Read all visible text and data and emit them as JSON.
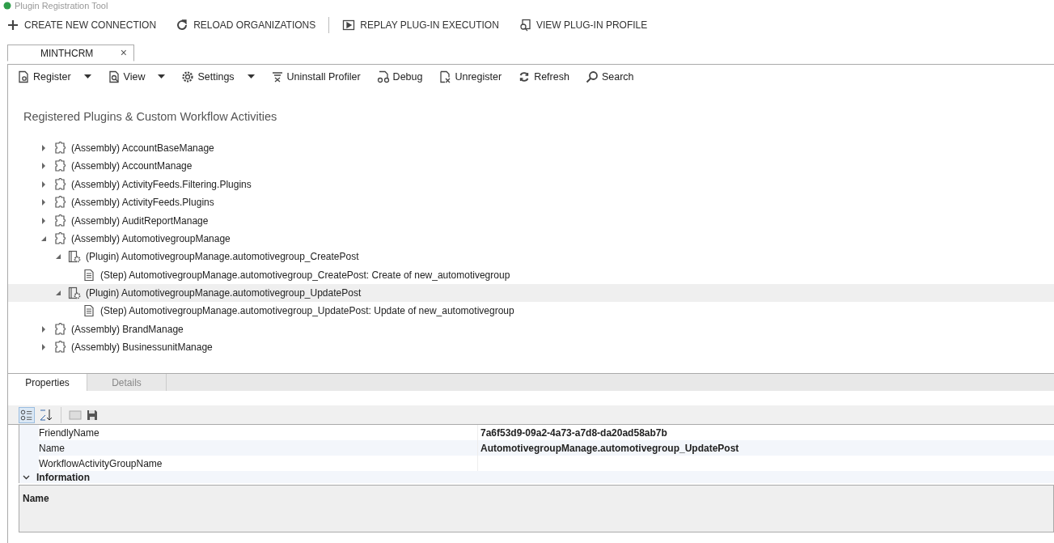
{
  "window": {
    "title": "Plugin Registration Tool"
  },
  "main_toolbar": [
    {
      "kind": "plus",
      "label": "CREATE NEW CONNECTION"
    },
    {
      "kind": "reload",
      "label": "RELOAD ORGANIZATIONS"
    },
    {
      "kind": "separator"
    },
    {
      "kind": "replay",
      "label": "REPLAY PLUG-IN EXECUTION"
    },
    {
      "kind": "profile",
      "label": "VIEW PLUG-IN PROFILE"
    }
  ],
  "connection_tabs": [
    {
      "label": "MINTHCRM",
      "close": "×",
      "selected": true
    }
  ],
  "toolbar": [
    {
      "kind": "register",
      "label": "Register",
      "dropdown": true
    },
    {
      "kind": "view",
      "label": "View",
      "dropdown": true
    },
    {
      "kind": "settings",
      "label": "Settings",
      "dropdown": true
    },
    {
      "kind": "uninstall",
      "label": "Uninstall Profiler",
      "dropdown": false
    },
    {
      "kind": "debug",
      "label": "Debug",
      "dropdown": false
    },
    {
      "kind": "unregister",
      "label": "Unregister",
      "dropdown": false
    },
    {
      "kind": "refresh",
      "label": "Refresh",
      "dropdown": false
    },
    {
      "kind": "search",
      "label": "Search",
      "dropdown": false
    }
  ],
  "tree": {
    "title": "Registered Plugins & Custom Workflow Activities",
    "items": [
      {
        "kind": "assembly",
        "label": "(Assembly) AccountBaseManage",
        "expanded": false,
        "selected": false
      },
      {
        "kind": "assembly",
        "label": "(Assembly) AccountManage",
        "expanded": false,
        "selected": false
      },
      {
        "kind": "assembly",
        "label": "(Assembly) ActivityFeeds.Filtering.Plugins",
        "expanded": false,
        "selected": false
      },
      {
        "kind": "assembly",
        "label": "(Assembly) ActivityFeeds.Plugins",
        "expanded": false,
        "selected": false
      },
      {
        "kind": "assembly",
        "label": "(Assembly) AuditReportManage",
        "expanded": false,
        "selected": false
      },
      {
        "kind": "assembly",
        "label": "(Assembly) AutomotivegroupManage",
        "expanded": true,
        "selected": false,
        "children": [
          {
            "kind": "plugin",
            "label": "(Plugin) AutomotivegroupManage.automotivegroup_CreatePost",
            "expanded": true,
            "selected": false,
            "children": [
              {
                "kind": "step",
                "label": "(Step) AutomotivegroupManage.automotivegroup_CreatePost: Create of new_automotivegroup",
                "selected": false
              }
            ]
          },
          {
            "kind": "plugin",
            "label": "(Plugin) AutomotivegroupManage.automotivegroup_UpdatePost",
            "expanded": true,
            "selected": true,
            "children": [
              {
                "kind": "step",
                "label": "(Step) AutomotivegroupManage.automotivegroup_UpdatePost: Update of new_automotivegroup",
                "selected": false
              }
            ]
          }
        ]
      },
      {
        "kind": "assembly",
        "label": "(Assembly) BrandManage",
        "expanded": false,
        "selected": false
      },
      {
        "kind": "assembly",
        "label": "(Assembly) BusinessunitManage",
        "expanded": false,
        "selected": false
      }
    ]
  },
  "bottom_tabs": [
    {
      "label": "Properties",
      "selected": true
    },
    {
      "label": "Details",
      "selected": false
    }
  ],
  "properties": {
    "rows": [
      {
        "name": "FriendlyName",
        "value": "7a6f53d9-09a2-4a73-a7d8-da20ad58ab7b",
        "selected": false
      },
      {
        "name": "Name",
        "value": "AutomotivegroupManage.automotivegroup_UpdatePost",
        "selected": true
      },
      {
        "name": "WorkflowActivityGroupName",
        "selected": false
      }
    ],
    "category": {
      "label": "Information",
      "expanded": true
    },
    "description": {
      "title": "Name"
    }
  }
}
